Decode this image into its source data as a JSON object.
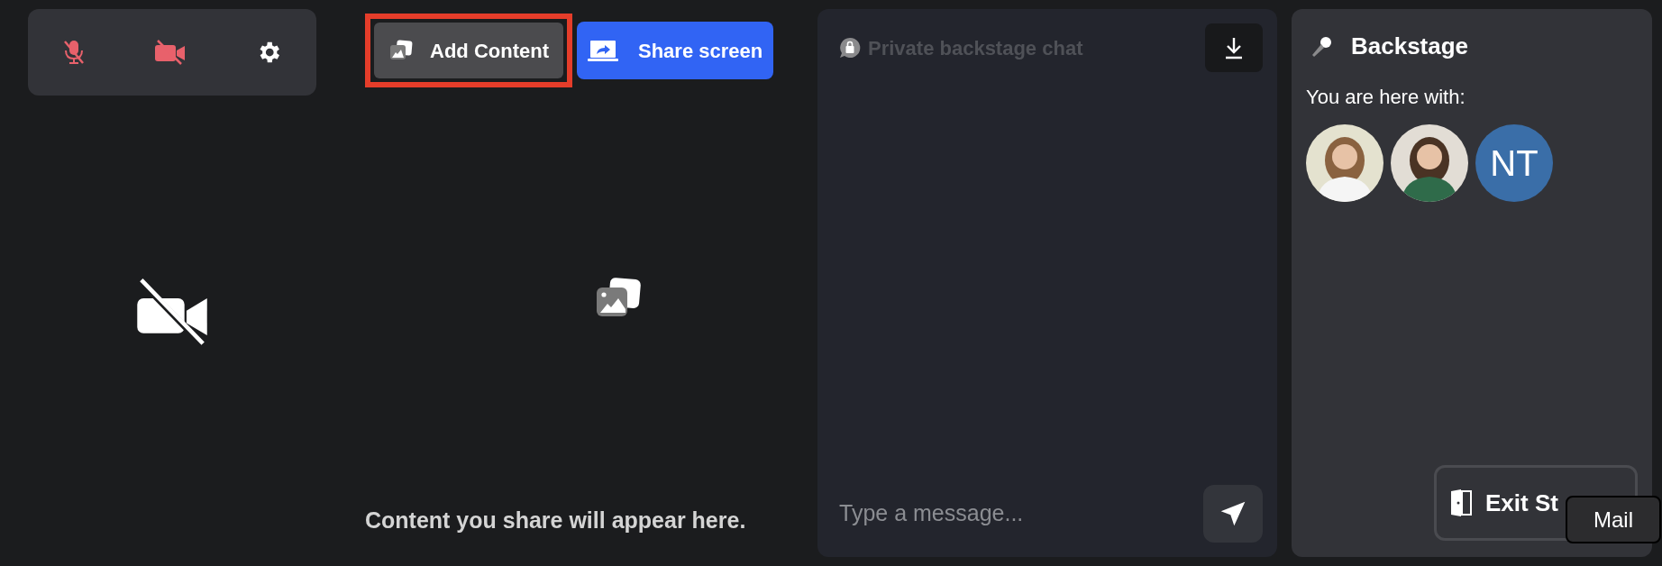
{
  "controls": {
    "mic_muted": true,
    "camera_off": true
  },
  "content_toolbar": {
    "add_content": {
      "label": "Add Content",
      "highlighted": true
    },
    "share_screen": {
      "label": "Share screen"
    }
  },
  "content_area": {
    "empty_text": "Content you share will appear here."
  },
  "chat": {
    "title": "Private backstage chat",
    "input": {
      "placeholder": "Type a message..."
    }
  },
  "backstage": {
    "title": "Backstage",
    "subtitle": "You are here with:",
    "participants": [
      {
        "kind": "picture"
      },
      {
        "kind": "picture"
      },
      {
        "kind": "initials",
        "initials": "NT",
        "color": "#3a6ea8"
      }
    ],
    "exit_button": {
      "label": "Exit St"
    },
    "tooltip": {
      "text": "Mail"
    }
  }
}
